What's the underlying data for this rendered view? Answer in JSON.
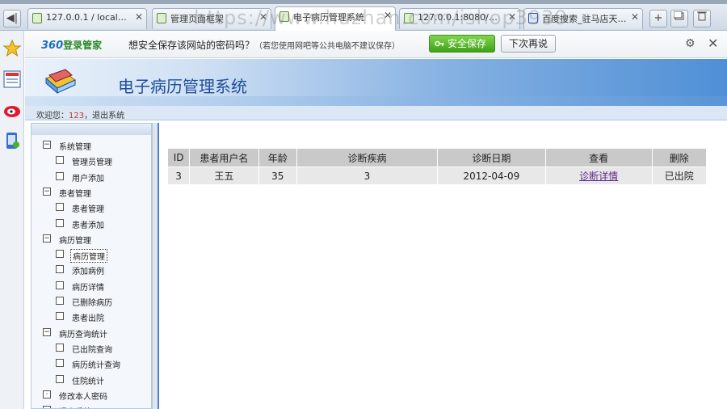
{
  "browser": {
    "tabs": [
      {
        "title": "127.0.0.1 / local…",
        "active": false
      },
      {
        "title": "管理页面框架",
        "active": false
      },
      {
        "title": "电子病历管理系统",
        "active": true
      },
      {
        "title": "127.0.0.1:8080/…",
        "active": false
      },
      {
        "title": "百度搜索_驻马店天…",
        "active": false
      }
    ],
    "tab_close": "✕",
    "new_tab": "+",
    "back": "◀|"
  },
  "password_bar": {
    "brand_num": "360",
    "brand_text": "登录管家",
    "message": "想安全保存该网站的密码吗？",
    "note": "（若您使用网吧等公共电脑不建议保存）",
    "save_label": "安全保存",
    "later_label": "下次再说",
    "gear": "⚙",
    "close": "✕"
  },
  "page": {
    "title": "电子病历管理系统",
    "welcome_prefix": "欢迎您：",
    "username": "123",
    "separator": "，",
    "logout": "退出系统"
  },
  "sidebar": {
    "items": [
      {
        "label": "系统管理",
        "level": 0,
        "toggle": "−"
      },
      {
        "label": "管理员管理",
        "level": 1
      },
      {
        "label": "用户添加",
        "level": 1
      },
      {
        "label": "患者管理",
        "level": 0,
        "toggle": "−"
      },
      {
        "label": "患者管理",
        "level": 1
      },
      {
        "label": "患者添加",
        "level": 1
      },
      {
        "label": "病历管理",
        "level": 0,
        "toggle": "−"
      },
      {
        "label": "病历管理",
        "level": 1,
        "selected": true
      },
      {
        "label": "添加病例",
        "level": 1
      },
      {
        "label": "病历详情",
        "level": 1
      },
      {
        "label": "已删除病历",
        "level": 1
      },
      {
        "label": "患者出院",
        "level": 1
      },
      {
        "label": "病历查询统计",
        "level": 0,
        "toggle": "−"
      },
      {
        "label": "已出院查询",
        "level": 1
      },
      {
        "label": "病历统计查询",
        "level": 1
      },
      {
        "label": "住院统计",
        "level": 1
      },
      {
        "label": "修改本人密码",
        "level": 0,
        "toggle": "·"
      },
      {
        "label": "退出系统",
        "level": 0,
        "toggle": "·"
      }
    ]
  },
  "table": {
    "headers": [
      "ID",
      "患者用户名",
      "年龄",
      "诊断疾病",
      "诊断日期",
      "查看",
      "删除"
    ],
    "rows": [
      {
        "id": "3",
        "name": "王五",
        "age": "35",
        "disease": "3",
        "date": "2012-04-09",
        "view": "诊断详情",
        "delete": "已出院"
      }
    ]
  },
  "watermark": "https://www.huzhan.com/ishop3939",
  "colors": {
    "accent": "#1e4f99",
    "save_green": "#3ea316",
    "link": "#5b2a86"
  }
}
